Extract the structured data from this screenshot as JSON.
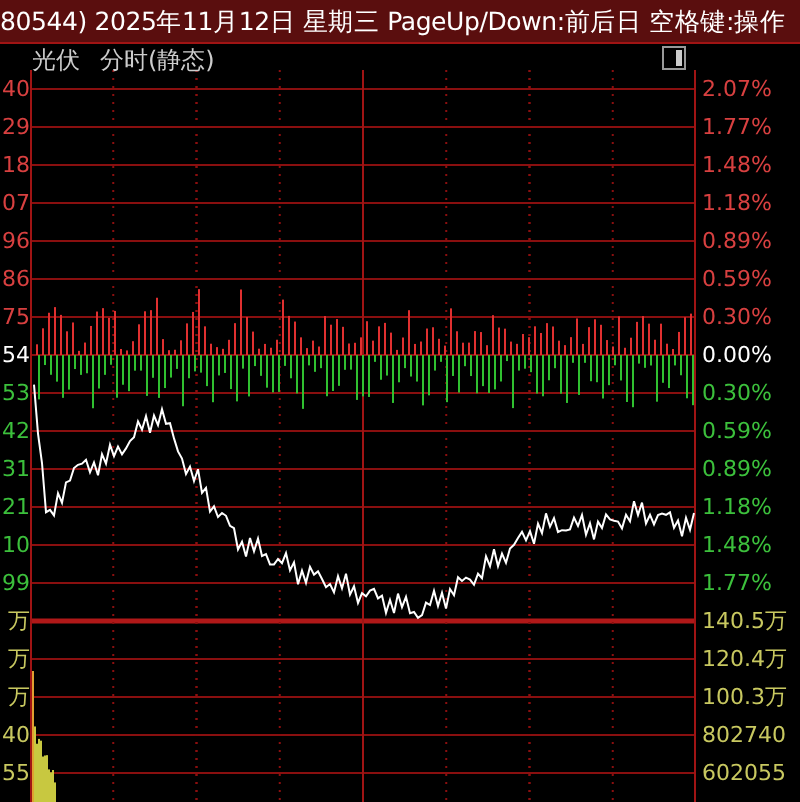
{
  "title_bar": {
    "text": "80544) 2025年11月12日 星期三 PageUp/Down:前后日 空格键:操作"
  },
  "header": {
    "sector": "光伏",
    "mode": "分时(静态)"
  },
  "left_axis": [
    {
      "text": "40",
      "kind": "up"
    },
    {
      "text": "29",
      "kind": "up"
    },
    {
      "text": "18",
      "kind": "up"
    },
    {
      "text": "07",
      "kind": "up"
    },
    {
      "text": "96",
      "kind": "up"
    },
    {
      "text": "86",
      "kind": "up"
    },
    {
      "text": "75",
      "kind": "up"
    },
    {
      "text": "54",
      "kind": "flat"
    },
    {
      "text": "53",
      "kind": "down"
    },
    {
      "text": "42",
      "kind": "down"
    },
    {
      "text": "31",
      "kind": "down"
    },
    {
      "text": "21",
      "kind": "down"
    },
    {
      "text": "10",
      "kind": "down"
    },
    {
      "text": "99",
      "kind": "down"
    },
    {
      "text": "万",
      "kind": "volume"
    },
    {
      "text": "万",
      "kind": "volume"
    },
    {
      "text": "万",
      "kind": "volume"
    },
    {
      "text": "40",
      "kind": "volume"
    },
    {
      "text": "55",
      "kind": "volume"
    }
  ],
  "right_axis": [
    {
      "text": "2.07%",
      "kind": "up"
    },
    {
      "text": "1.77%",
      "kind": "up"
    },
    {
      "text": "1.48%",
      "kind": "up"
    },
    {
      "text": "1.18%",
      "kind": "up"
    },
    {
      "text": "0.89%",
      "kind": "up"
    },
    {
      "text": "0.59%",
      "kind": "up"
    },
    {
      "text": "0.30%",
      "kind": "up"
    },
    {
      "text": "0.00%",
      "kind": "flat"
    },
    {
      "text": "0.30%",
      "kind": "down"
    },
    {
      "text": "0.59%",
      "kind": "down"
    },
    {
      "text": "0.89%",
      "kind": "down"
    },
    {
      "text": "1.18%",
      "kind": "down"
    },
    {
      "text": "1.48%",
      "kind": "down"
    },
    {
      "text": "1.77%",
      "kind": "down"
    },
    {
      "text": "140.5万",
      "kind": "volume"
    },
    {
      "text": "120.4万",
      "kind": "volume"
    },
    {
      "text": "100.3万",
      "kind": "volume"
    },
    {
      "text": "802740",
      "kind": "volume"
    },
    {
      "text": "602055",
      "kind": "volume"
    }
  ]
}
